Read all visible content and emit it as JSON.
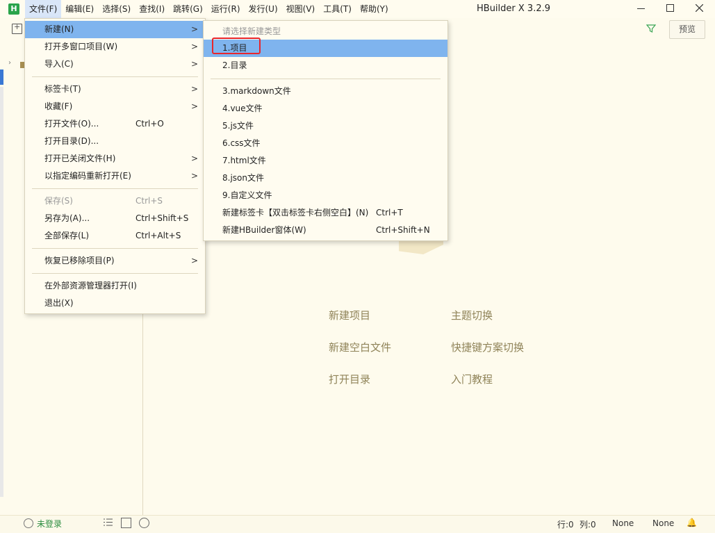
{
  "window": {
    "logo": "H",
    "title": "HBuilder X 3.2.9",
    "controls": {
      "minimize": "—",
      "maximize": "☐",
      "close": "✕"
    }
  },
  "menubar": [
    "文件(F)",
    "编辑(E)",
    "选择(S)",
    "查找(I)",
    "跳转(G)",
    "运行(R)",
    "发行(U)",
    "视图(V)",
    "工具(T)",
    "帮助(Y)"
  ],
  "toolbar": {
    "preview_label": "预览"
  },
  "file_menu": {
    "new": "新建(N)",
    "open_multi": "打开多窗口项目(W)",
    "import": "导入(C)",
    "tabs": "标签卡(T)",
    "favorites": "收藏(F)",
    "open_file": "打开文件(O)...",
    "open_file_shortcut": "Ctrl+O",
    "open_dir": "打开目录(D)...",
    "open_closed": "打开已关闭文件(H)",
    "reopen_encoding": "以指定编码重新打开(E)",
    "save": "保存(S)",
    "save_shortcut": "Ctrl+S",
    "save_as": "另存为(A)...",
    "save_as_shortcut": "Ctrl+Shift+S",
    "save_all": "全部保存(L)",
    "save_all_shortcut": "Ctrl+Alt+S",
    "restore_removed": "恢复已移除项目(P)",
    "open_explorer": "在外部资源管理器打开(I)",
    "exit": "退出(X)"
  },
  "new_submenu": {
    "header": "请选择新建类型",
    "items": [
      "1.项目",
      "2.目录",
      "3.markdown文件",
      "4.vue文件",
      "5.js文件",
      "6.css文件",
      "7.html文件",
      "8.json文件",
      "9.自定义文件"
    ],
    "new_tab": "新建标签卡【双击标签卡右侧空白】(N)",
    "new_tab_shortcut": "Ctrl+T",
    "new_window": "新建HBuilder窗体(W)",
    "new_window_shortcut": "Ctrl+Shift+N"
  },
  "welcome": {
    "new_project": "新建项目",
    "theme_switch": "主题切换",
    "new_blank_file": "新建空白文件",
    "keymap_switch": "快捷键方案切换",
    "open_dir": "打开目录",
    "tutorial": "入门教程"
  },
  "statusbar": {
    "login": "未登录",
    "line": "行:0",
    "col": "列:0",
    "encoding": "None",
    "syntax": "None"
  },
  "icons": {
    "bell": "bell-icon",
    "filter": "filter-icon",
    "new_file": "new-file-icon"
  }
}
